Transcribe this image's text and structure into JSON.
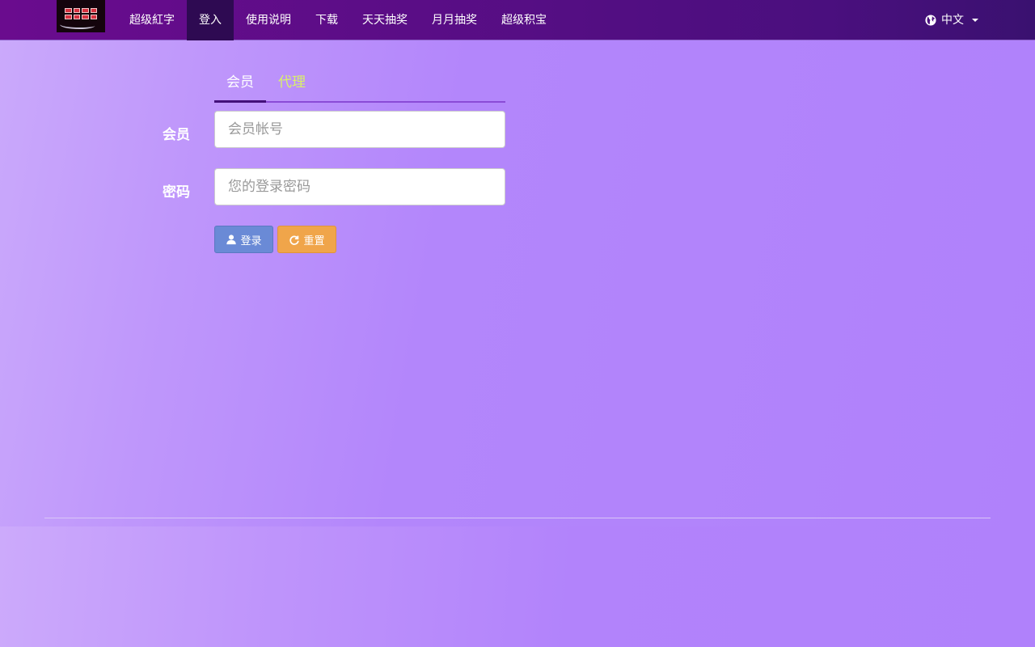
{
  "navbar": {
    "logo_icon": "logo-icon",
    "items": [
      {
        "label": "超级紅字",
        "active": false
      },
      {
        "label": "登入",
        "active": true
      },
      {
        "label": "使用说明",
        "active": false
      },
      {
        "label": "下载",
        "active": false
      },
      {
        "label": "天天抽奖",
        "active": false
      },
      {
        "label": "月月抽奖",
        "active": false
      },
      {
        "label": "超级积宝",
        "active": false
      }
    ],
    "language": {
      "label": "中文",
      "icon": "globe-icon"
    }
  },
  "login": {
    "tabs": [
      {
        "label": "会员",
        "active": true
      },
      {
        "label": "代理",
        "active": false
      }
    ],
    "member_label": "会员",
    "member_placeholder": "会员帐号",
    "member_value": "",
    "password_label": "密码",
    "password_placeholder": "您的登录密码",
    "password_value": "",
    "login_button": {
      "label": "登录",
      "icon": "user-icon"
    },
    "reset_button": {
      "label": "重置",
      "icon": "refresh-icon"
    }
  },
  "colors": {
    "navbar": "#5a0d86",
    "nav_active": "#2e0a52",
    "background": "#b184fb",
    "tab_inactive": "#d9f06a",
    "login_button": "#6a8ad6",
    "reset_button": "#f0a54a"
  }
}
